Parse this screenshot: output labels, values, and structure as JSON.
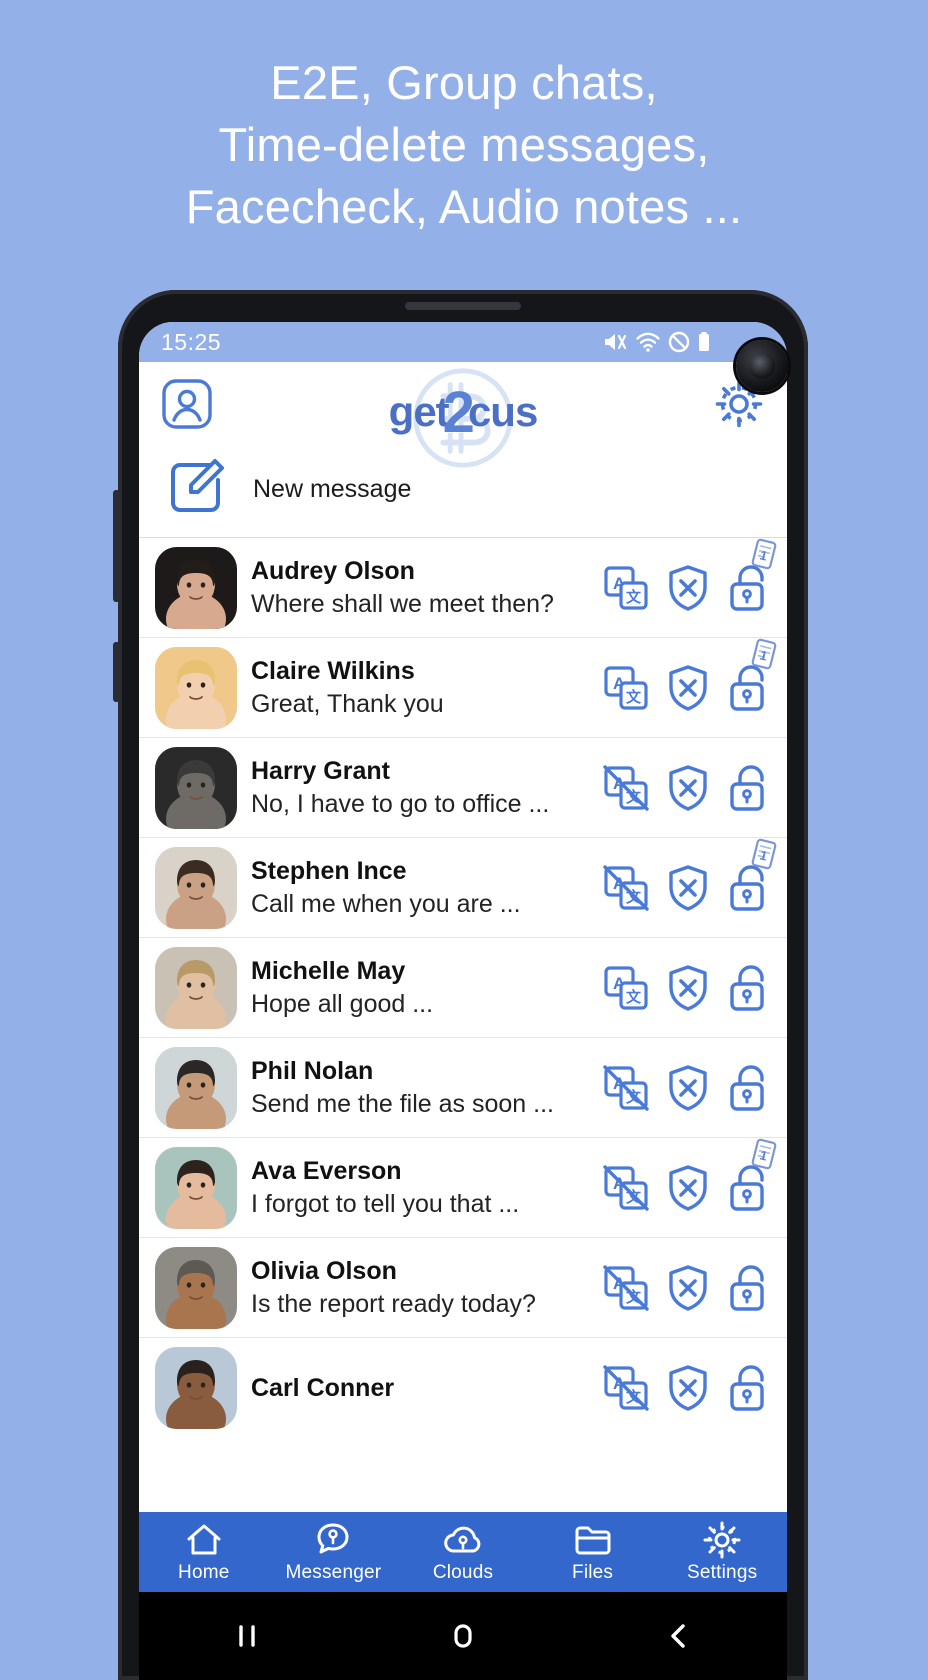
{
  "promo": {
    "line1": "E2E, Group chats,",
    "line2": "Time-delete messages,",
    "line3": "Facecheck, Audio notes ..."
  },
  "colors": {
    "background": "#94b0e8",
    "accent": "#3367cc",
    "icon_blue": "#4a7ad6",
    "logo_blue": "#4a6fc4",
    "nav_bar": "#3367cc"
  },
  "statusbar": {
    "time": "15:25",
    "icons": [
      "volume-mute-icon",
      "wifi-icon",
      "do-not-disturb-icon",
      "battery-icon"
    ]
  },
  "header": {
    "profile_icon": "profile-icon",
    "logo_text_a": "get",
    "logo_text_2": "2",
    "logo_text_b": "cus",
    "settings_icon": "gear-icon"
  },
  "new_message": {
    "icon": "compose-icon",
    "label": "New message"
  },
  "chats": [
    {
      "name": "Audrey Olson",
      "preview": "Where shall we meet then?",
      "translate": "enabled",
      "shield": "shield-x-icon",
      "lock": "unlocked-padlock-icon",
      "badge": "1"
    },
    {
      "name": "Claire Wilkins",
      "preview": "Great, Thank you",
      "translate": "enabled",
      "shield": "shield-x-icon",
      "lock": "unlocked-padlock-icon",
      "badge": "1"
    },
    {
      "name": "Harry Grant",
      "preview": "No, I have to go to office ...",
      "translate": "disabled",
      "shield": "shield-x-icon",
      "lock": "unlocked-padlock-icon",
      "badge": ""
    },
    {
      "name": "Stephen Ince",
      "preview": "Call me when you are ...",
      "translate": "disabled",
      "shield": "shield-x-icon",
      "lock": "unlocked-padlock-icon",
      "badge": "1"
    },
    {
      "name": "Michelle May",
      "preview": "Hope all good ...",
      "translate": "enabled",
      "shield": "shield-x-icon",
      "lock": "unlocked-padlock-icon",
      "badge": ""
    },
    {
      "name": "Phil Nolan",
      "preview": "Send me the file as soon ...",
      "translate": "disabled",
      "shield": "shield-x-icon",
      "lock": "unlocked-padlock-icon",
      "badge": ""
    },
    {
      "name": "Ava Everson",
      "preview": "I forgot to tell you that ...",
      "translate": "disabled",
      "shield": "shield-x-icon",
      "lock": "unlocked-padlock-icon",
      "badge": "1"
    },
    {
      "name": "Olivia Olson",
      "preview": "Is the report ready today?",
      "translate": "disabled",
      "shield": "shield-x-icon",
      "lock": "unlocked-padlock-icon",
      "badge": ""
    },
    {
      "name": "Carl Conner",
      "preview": "",
      "translate": "disabled",
      "shield": "shield-x-icon",
      "lock": "unlocked-padlock-icon",
      "badge": ""
    }
  ],
  "bottom_nav": {
    "items": [
      {
        "label": "Home",
        "icon": "home-icon"
      },
      {
        "label": "Messenger",
        "icon": "message-key-icon"
      },
      {
        "label": "Clouds",
        "icon": "cloud-key-icon"
      },
      {
        "label": "Files",
        "icon": "folder-icon"
      },
      {
        "label": "Settings",
        "icon": "gear-icon"
      }
    ]
  },
  "system_bar": {
    "recents": "recents-icon",
    "home": "home-pill-icon",
    "back": "back-chevron-icon"
  }
}
